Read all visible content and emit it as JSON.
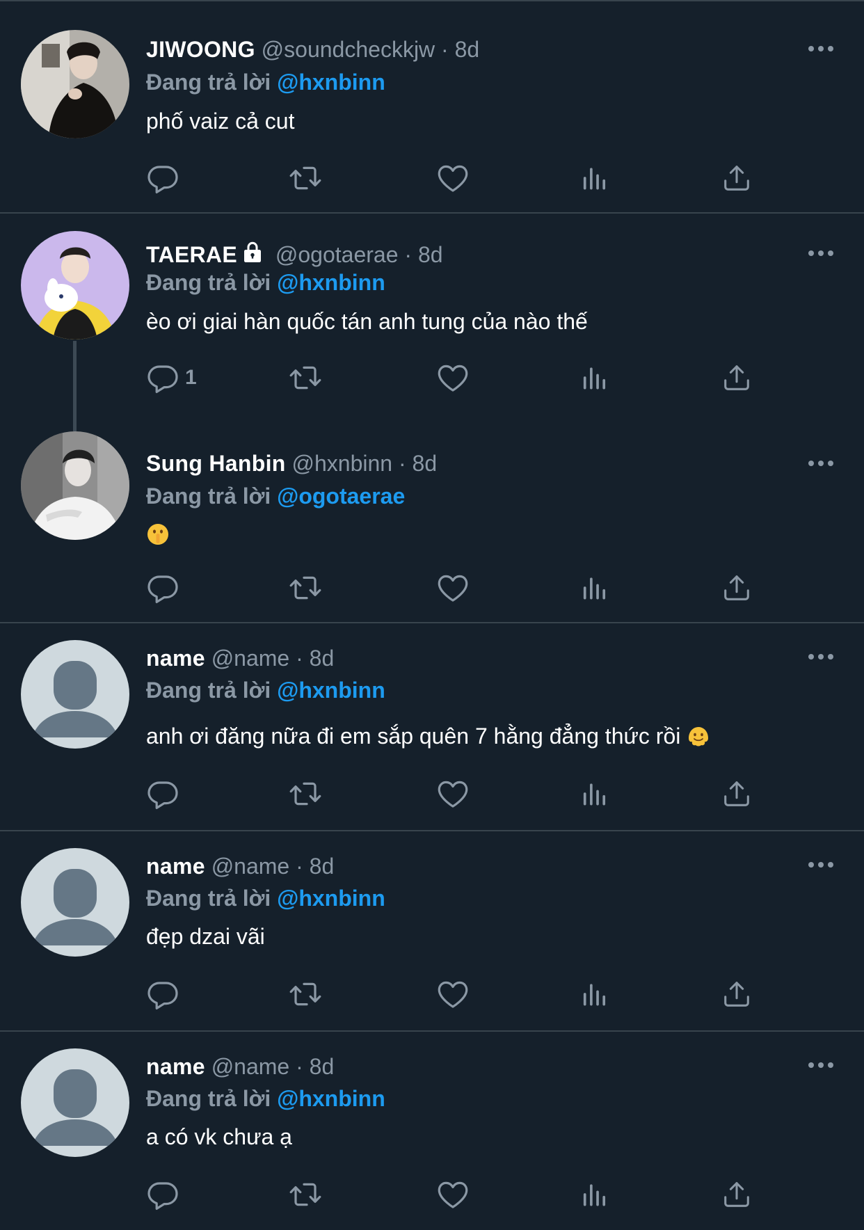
{
  "colors": {
    "background": "#15202b",
    "divider": "#38444d",
    "secondary_text": "#8b98a5",
    "accent": "#1d9bf0",
    "icon": "#8b98a5"
  },
  "reply_prefix": "Đang trả lời",
  "dot": "·",
  "tweets": [
    {
      "display_name": "JIWOONG",
      "handle": "@soundcheckkjw",
      "time": "8d",
      "reply_to": "@hxnbinn",
      "text": "phố vaiz cả cut",
      "avatar": "photo-avatar",
      "reply_count": ""
    },
    {
      "display_name": "TAERAE",
      "handle": "@ogotaerae",
      "time": "8d",
      "reply_to": "@hxnbinn",
      "text": "èo ơi giai hàn quốc tán anh tung của nào thế",
      "avatar": "photo-avatar",
      "protected_icon": "lock-icon",
      "reply_count": "1"
    },
    {
      "display_name": "Sung Hanbin",
      "handle": "@hxnbinn",
      "time": "8d",
      "reply_to": "@ogotaerae",
      "text": "",
      "emoji": "shushing-face-emoji",
      "avatar": "photo-avatar",
      "reply_count": ""
    },
    {
      "display_name": "name",
      "handle": "@name",
      "time": "8d",
      "reply_to": "@hxnbinn",
      "text": "anh ơi đăng nữa đi em sắp quên 7 hằng đẳng thức rồi",
      "emoji": "melting-face-emoji",
      "avatar": "default-avatar",
      "reply_count": ""
    },
    {
      "display_name": "name",
      "handle": "@name",
      "time": "8d",
      "reply_to": "@hxnbinn",
      "text": "đẹp dzai vãi",
      "avatar": "default-avatar",
      "reply_count": ""
    },
    {
      "display_name": "name",
      "handle": "@name",
      "time": "8d",
      "reply_to": "@hxnbinn",
      "text": "a có vk chưa ạ",
      "avatar": "default-avatar",
      "reply_count": ""
    }
  ],
  "action_icons": [
    "reply-icon",
    "retweet-icon",
    "like-icon",
    "views-icon",
    "share-icon"
  ]
}
